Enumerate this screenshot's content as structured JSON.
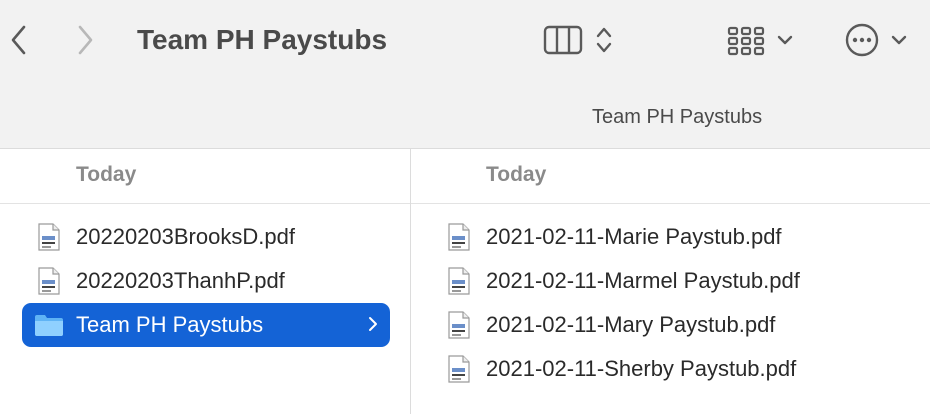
{
  "toolbar": {
    "title": "Team PH Paystubs",
    "path_label": "Team PH Paystubs",
    "icons": {
      "back": "chevron-left-icon",
      "forward": "chevron-right-icon",
      "view": "columns-view-icon",
      "group": "grid-group-icon",
      "action": "ellipsis-circle-icon"
    }
  },
  "columns": [
    {
      "header": "Today",
      "items": [
        {
          "name": "20220203BrooksD.pdf",
          "type": "pdf"
        },
        {
          "name": "20220203ThanhP.pdf",
          "type": "pdf"
        },
        {
          "name": "Team PH Paystubs",
          "type": "folder",
          "selected": true
        }
      ]
    },
    {
      "header": "Today",
      "items": [
        {
          "name": "2021-02-11-Marie Paystub.pdf",
          "type": "pdf"
        },
        {
          "name": "2021-02-11-Marmel Paystub.pdf",
          "type": "pdf"
        },
        {
          "name": "2021-02-11-Mary Paystub.pdf",
          "type": "pdf"
        },
        {
          "name": "2021-02-11-Sherby Paystub.pdf",
          "type": "pdf"
        }
      ]
    }
  ],
  "colors": {
    "selection": "#1463d6",
    "folder": "#5fb3f5"
  }
}
